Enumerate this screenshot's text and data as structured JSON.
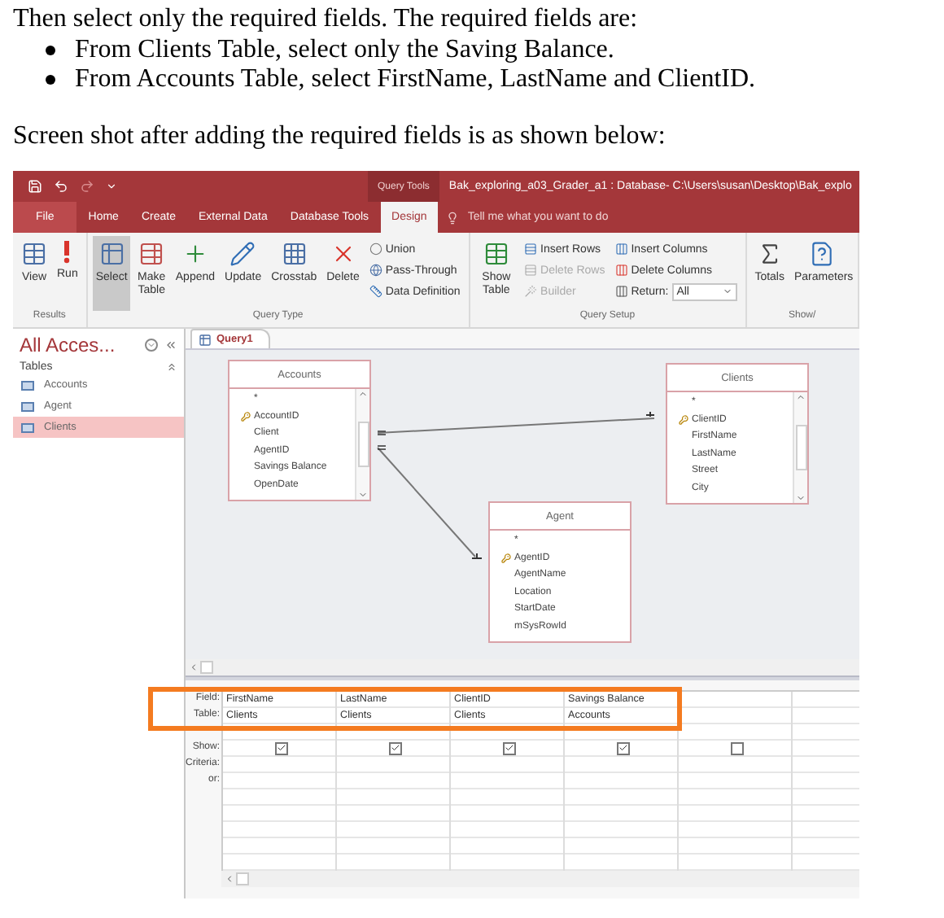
{
  "document": {
    "intro": "Then select only the required fields. The required fields are:",
    "bullets": [
      "From Clients Table, select only the Saving Balance.",
      "From Accounts Table, select FirstName, LastName and ClientID."
    ],
    "caption": "Screen shot after adding the required fields is as shown below:"
  },
  "app": {
    "title_bar": {
      "context_label": "Query Tools",
      "title": "Bak_exploring_a03_Grader_a1 : Database- C:\\Users\\susan\\Desktop\\Bak_explo"
    },
    "ribbon_tabs": [
      {
        "label": "File",
        "kind": "file",
        "selected": false
      },
      {
        "label": "Home",
        "kind": "tab",
        "selected": false
      },
      {
        "label": "Create",
        "kind": "tab",
        "selected": false
      },
      {
        "label": "External Data",
        "kind": "tab",
        "selected": false
      },
      {
        "label": "Database Tools",
        "kind": "tab",
        "selected": false
      },
      {
        "label": "Design",
        "kind": "tab",
        "selected": true
      }
    ],
    "tell_me": {
      "placeholder": "Tell me what you want to do"
    },
    "ribbon_groups": [
      {
        "label": "Results",
        "items": [
          {
            "kind": "large",
            "label": "View",
            "selected": false,
            "disabled": false
          },
          {
            "kind": "large",
            "label": "Run",
            "selected": false,
            "disabled": false
          }
        ]
      },
      {
        "label": "Query Type",
        "items": [
          {
            "kind": "large",
            "label": "Select",
            "selected": true,
            "disabled": false
          },
          {
            "kind": "large",
            "label": "Make Table",
            "selected": false,
            "disabled": false
          },
          {
            "kind": "large",
            "label": "Append",
            "selected": false,
            "disabled": false
          },
          {
            "kind": "large",
            "label": "Update",
            "selected": false,
            "disabled": false
          },
          {
            "kind": "large",
            "label": "Crosstab",
            "selected": false,
            "disabled": false
          },
          {
            "kind": "large",
            "label": "Delete",
            "selected": false,
            "disabled": false
          },
          {
            "kind": "small",
            "label": "Union",
            "selected": false,
            "disabled": false
          },
          {
            "kind": "small",
            "label": "Pass-Through",
            "selected": false,
            "disabled": false
          },
          {
            "kind": "small",
            "label": "Data Definition",
            "selected": false,
            "disabled": false
          }
        ]
      },
      {
        "label": "Query Setup",
        "items": [
          {
            "kind": "large",
            "label": "Show Table",
            "selected": false,
            "disabled": false
          },
          {
            "kind": "small",
            "label": "Insert Rows",
            "selected": false,
            "disabled": false
          },
          {
            "kind": "small",
            "label": "Delete Rows",
            "selected": false,
            "disabled": true
          },
          {
            "kind": "small",
            "label": "Builder",
            "selected": false,
            "disabled": true
          },
          {
            "kind": "small",
            "label": "Insert Columns",
            "selected": false,
            "disabled": false
          },
          {
            "kind": "small",
            "label": "Delete Columns",
            "selected": false,
            "disabled": false
          },
          {
            "kind": "dropdown",
            "label": "Return:",
            "value": "All",
            "selected": false,
            "disabled": false
          }
        ]
      },
      {
        "label": "Show/",
        "items": [
          {
            "kind": "large",
            "label": "Totals",
            "selected": false,
            "disabled": false
          },
          {
            "kind": "large",
            "label": "Parameters",
            "selected": false,
            "disabled": false
          }
        ]
      }
    ],
    "navigation": {
      "title": "All Acces...",
      "section": "Tables",
      "items": [
        {
          "label": "Accounts",
          "selected": false
        },
        {
          "label": "Agent",
          "selected": false
        },
        {
          "label": "Clients",
          "selected": true
        }
      ]
    },
    "document_tabs": [
      {
        "label": "Query1",
        "selected": true
      }
    ],
    "design_tables": [
      {
        "name": "Accounts",
        "kind": "scrolling",
        "fields": [
          {
            "name": "*",
            "key": false
          },
          {
            "name": "AccountID",
            "key": true
          },
          {
            "name": "Client",
            "key": false
          },
          {
            "name": "AgentID",
            "key": false
          },
          {
            "name": "Savings Balance",
            "key": false
          },
          {
            "name": "OpenDate",
            "key": false
          }
        ]
      },
      {
        "name": "Clients",
        "kind": "scrolling",
        "fields": [
          {
            "name": "*",
            "key": false
          },
          {
            "name": "ClientID",
            "key": true
          },
          {
            "name": "FirstName",
            "key": false
          },
          {
            "name": "LastName",
            "key": false
          },
          {
            "name": "Street",
            "key": false
          },
          {
            "name": "City",
            "key": false
          }
        ]
      },
      {
        "name": "Agent",
        "kind": "plain",
        "fields": [
          {
            "name": "*",
            "key": false
          },
          {
            "name": "AgentID",
            "key": true
          },
          {
            "name": "AgentName",
            "key": false
          },
          {
            "name": "Location",
            "key": false
          },
          {
            "name": "StartDate",
            "key": false
          },
          {
            "name": "mSysRowId",
            "key": false
          }
        ]
      }
    ],
    "grid": {
      "row_labels": {
        "field": "Field:",
        "table": "Table:",
        "show": "Show:",
        "criteria": "Criteria:",
        "or": "or:"
      },
      "columns": [
        {
          "field": "FirstName",
          "table": "Clients",
          "show": true,
          "highlighted": true
        },
        {
          "field": "LastName",
          "table": "Clients",
          "show": true,
          "highlighted": true
        },
        {
          "field": "ClientID",
          "table": "Clients",
          "show": true,
          "highlighted": true
        },
        {
          "field": "Savings Balance",
          "table": "Accounts",
          "show": true,
          "highlighted": true
        },
        {
          "show": false,
          "highlighted": false
        }
      ]
    }
  }
}
